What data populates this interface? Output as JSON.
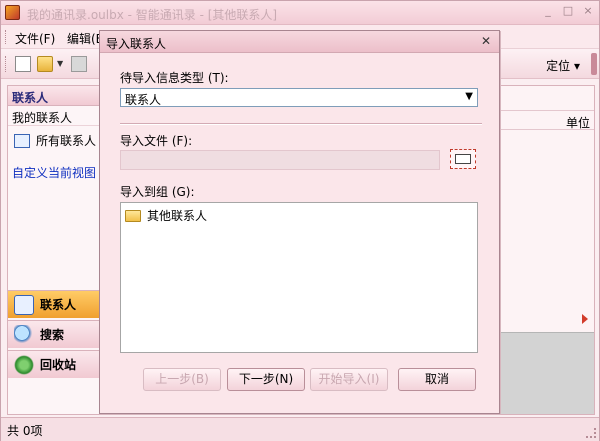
{
  "main_window": {
    "title": "我的通讯录.oulbx - 智能通讯录 - [其他联系人]",
    "controls": [
      "_",
      "□",
      "×"
    ]
  },
  "menubar": {
    "items": [
      "文件(F)",
      "编辑(E)"
    ]
  },
  "toolbar": {
    "locate_label": "定位 ▾"
  },
  "left_panel": {
    "header": "联系人",
    "subheader": "我的联系人",
    "all_contacts": "所有联系人",
    "custom_view": "自定义当前视图",
    "nav": {
      "contacts": "联系人",
      "search": "搜索",
      "recycle": "回收站"
    }
  },
  "right_panel": {
    "column_label": "单位"
  },
  "statusbar": {
    "text": "共 0项"
  },
  "dialog": {
    "title": "导入联系人",
    "close": "✕",
    "type_label": "待导入信息类型 (T):",
    "type_value": "联系人",
    "file_label": "导入文件 (F):",
    "file_value": "",
    "group_label": "导入到组 (G):",
    "group_items": [
      "其他联系人"
    ],
    "buttons": {
      "prev": "上一步(B)",
      "next": "下一步(N)",
      "start": "开始导入(I)",
      "cancel": "取消"
    }
  },
  "colors": {
    "dialog_bg": "#fbe6ea",
    "nav_active": "#f0a030",
    "link": "#1030c0"
  },
  "icons": [
    "app-icon",
    "new-file-icon",
    "open-folder-icon",
    "save-icon",
    "contacts-icon",
    "search-icon",
    "recycle-icon",
    "folder-icon",
    "browse-icon",
    "close-icon"
  ]
}
